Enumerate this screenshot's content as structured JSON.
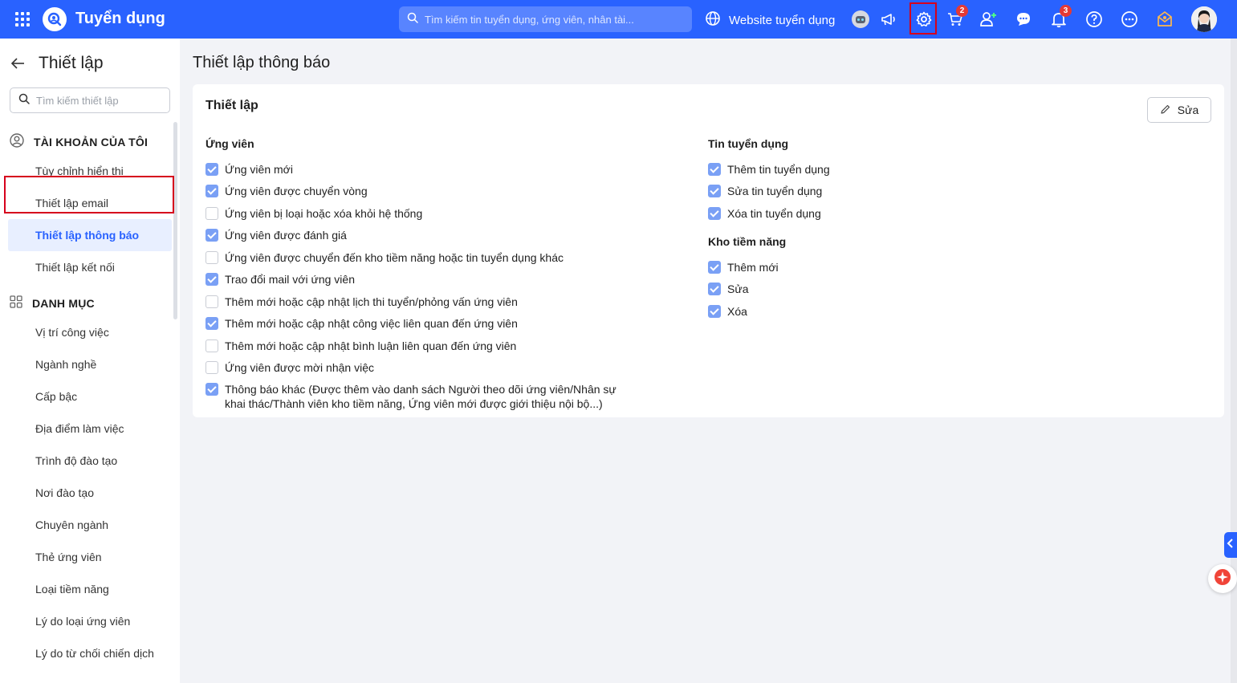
{
  "header": {
    "app_title": "Tuyển dụng",
    "search_placeholder": "Tìm kiếm tin tuyển dụng, ứng viên, nhân tài...",
    "website_label": "Website tuyển dụng",
    "cart_badge": "2",
    "notification_badge": "3",
    "brand_color": "#2962ff",
    "icons": [
      "apps-grid-icon",
      "robot-icon",
      "megaphone-icon",
      "gear-icon",
      "cart-icon",
      "add-user-icon",
      "chat-icon",
      "bell-icon",
      "help-icon",
      "more-icon",
      "gift-icon"
    ]
  },
  "sidebar": {
    "title": "Thiết lập",
    "search_placeholder": "Tìm kiếm thiết lập",
    "account_section": {
      "heading": "TÀI KHOẢN CỦA TÔI",
      "items": [
        "Tùy chỉnh hiển thị",
        "Thiết lập email",
        "Thiết lập thông báo",
        "Thiết lập kết nối"
      ],
      "active": "Thiết lập thông báo"
    },
    "catalog_section": {
      "heading": "DANH MỤC",
      "items": [
        "Vị trí công việc",
        "Ngành nghề",
        "Cấp bậc",
        "Địa điểm làm việc",
        "Trình độ đào tạo",
        "Nơi đào tạo",
        "Chuyên ngành",
        "Thẻ ứng viên",
        "Loại tiềm năng",
        "Lý do loại ứng viên",
        "Lý do từ chối chiến dịch"
      ]
    }
  },
  "main": {
    "page_title": "Thiết lập thông báo",
    "card_title": "Thiết lập",
    "edit_label": "Sửa",
    "candidate_group": {
      "title": "Ứng viên",
      "options": [
        {
          "label": "Ứng viên mới",
          "checked": true
        },
        {
          "label": "Ứng viên được chuyển vòng",
          "checked": true
        },
        {
          "label": "Ứng viên bị loại hoặc xóa khỏi hệ thống",
          "checked": false
        },
        {
          "label": "Ứng viên được đánh giá",
          "checked": true
        },
        {
          "label": "Ứng viên được chuyển đến kho tiềm năng hoặc tin tuyển dụng khác",
          "checked": false
        },
        {
          "label": "Trao đổi mail với ứng viên",
          "checked": true
        },
        {
          "label": "Thêm mới hoặc cập nhật lịch thi tuyển/phỏng vấn ứng viên",
          "checked": false
        },
        {
          "label": "Thêm mới hoặc cập nhật công việc liên quan đến ứng viên",
          "checked": true
        },
        {
          "label": "Thêm mới hoặc cập nhật bình luận liên quan đến ứng viên",
          "checked": false
        },
        {
          "label": "Ứng viên được mời nhận việc",
          "checked": false
        },
        {
          "label": "Thông báo khác (Được thêm vào danh sách Người theo dõi ứng viên/Nhân sự khai thác/Thành viên kho tiềm năng, Ứng viên mới được giới thiệu nội bộ...)",
          "checked": true
        }
      ]
    },
    "job_group": {
      "title": "Tin tuyển dụng",
      "options": [
        {
          "label": "Thêm tin tuyển dụng",
          "checked": true
        },
        {
          "label": "Sửa tin tuyển dụng",
          "checked": true
        },
        {
          "label": "Xóa tin tuyển dụng",
          "checked": true
        }
      ]
    },
    "talent_group": {
      "title": "Kho tiềm năng",
      "options": [
        {
          "label": "Thêm mới",
          "checked": true
        },
        {
          "label": "Sửa",
          "checked": true
        },
        {
          "label": "Xóa",
          "checked": true
        }
      ]
    }
  }
}
